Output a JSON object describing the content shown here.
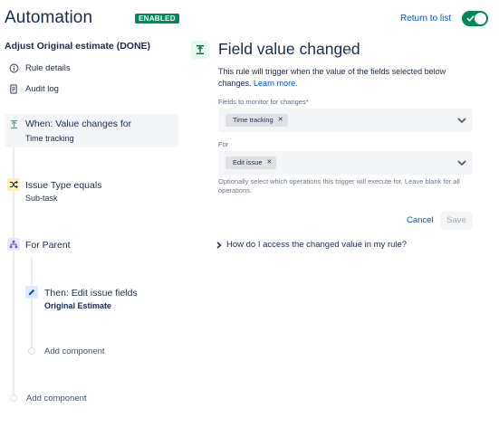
{
  "header": {
    "title": "Automation",
    "status_badge": "ENABLED",
    "return_link": "Return to list",
    "toggle_on": true
  },
  "sidebar": {
    "rule_name": "Adjust Original estimate (DONE)",
    "links": [
      {
        "label": "Rule details",
        "icon": "info-icon"
      },
      {
        "label": "Audit log",
        "icon": "document-icon"
      }
    ],
    "steps": [
      {
        "title": "When: Value changes for",
        "subtitle": "Time tracking",
        "icon": "field-change-icon",
        "color": "#36b37e",
        "selected": true
      },
      {
        "title": "Issue Type equals",
        "subtitle": "Sub-task",
        "icon": "shuffle-icon",
        "color": "#ffab00"
      },
      {
        "title": "For Parent",
        "icon": "hierarchy-icon",
        "color": "#6554c0"
      },
      {
        "title": "Then: Edit issue fields",
        "subtitle": "Original Estimate",
        "icon": "pencil-icon",
        "color": "#0065ff"
      }
    ],
    "add_component_inner": "Add component",
    "add_component_outer": "Add component"
  },
  "panel": {
    "title": "Field value changed",
    "description": "This rule will trigger when the value of the fields selected below changes.",
    "learn_more": "Learn more.",
    "fields_label": "Fields to monitor for changes",
    "required_mark": "*",
    "fields_value": "Time tracking",
    "for_label": "For",
    "for_value": "Edit issue",
    "hint": "Optionally select which operations this trigger will execute for. Leave blank for all operations.",
    "cancel_label": "Cancel",
    "save_label": "Save",
    "faq": "How do I access the changed value in my rule?"
  },
  "colors": {
    "accent": "#0052cc",
    "success": "#00875a",
    "text": "#172b4d"
  }
}
